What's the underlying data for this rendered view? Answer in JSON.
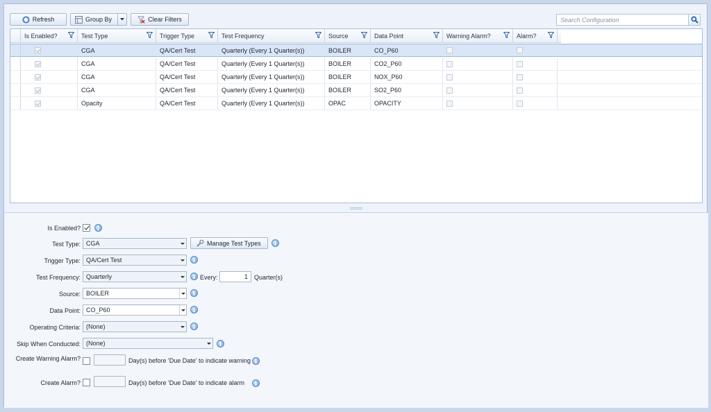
{
  "toolbar": {
    "refresh_label": "Refresh",
    "group_by_label": "Group By",
    "clear_filters_label": "Clear Filters",
    "search_placeholder": "Search Configuration"
  },
  "grid": {
    "columns": [
      "Is Enabled?",
      "Test Type",
      "Trigger Type",
      "Test Frequency",
      "Source",
      "Data Point",
      "Warning Alarm?",
      "Alarm?"
    ],
    "rows": [
      {
        "enabled": true,
        "test_type": "CGA",
        "trigger_type": "QA/Cert Test",
        "frequency": "Quarterly (Every 1 Quarter(s))",
        "source": "BOILER",
        "data_point": "CO_P60",
        "warning_alarm": false,
        "alarm": false,
        "selected": true
      },
      {
        "enabled": true,
        "test_type": "CGA",
        "trigger_type": "QA/Cert Test",
        "frequency": "Quarterly (Every 1 Quarter(s))",
        "source": "BOILER",
        "data_point": "CO2_P60",
        "warning_alarm": false,
        "alarm": false,
        "selected": false
      },
      {
        "enabled": true,
        "test_type": "CGA",
        "trigger_type": "QA/Cert Test",
        "frequency": "Quarterly (Every 1 Quarter(s))",
        "source": "BOILER",
        "data_point": "NOX_P60",
        "warning_alarm": false,
        "alarm": false,
        "selected": false
      },
      {
        "enabled": true,
        "test_type": "CGA",
        "trigger_type": "QA/Cert Test",
        "frequency": "Quarterly (Every 1 Quarter(s))",
        "source": "BOILER",
        "data_point": "SO2_P60",
        "warning_alarm": false,
        "alarm": false,
        "selected": false
      },
      {
        "enabled": true,
        "test_type": "Opacity",
        "trigger_type": "QA/Cert Test",
        "frequency": "Quarterly (Every 1 Quarter(s))",
        "source": "OPAC",
        "data_point": "OPACITY",
        "warning_alarm": false,
        "alarm": false,
        "selected": false
      }
    ]
  },
  "form": {
    "is_enabled_label": "Is Enabled?",
    "is_enabled": true,
    "test_type_label": "Test Type:",
    "test_type_value": "CGA",
    "manage_test_types_label": "Manage Test Types",
    "trigger_type_label": "Trigger Type:",
    "trigger_type_value": "QA/Cert Test",
    "test_frequency_label": "Test Frequency:",
    "test_frequency_value": "Quarterly",
    "every_label": "Every:",
    "every_value": "1",
    "every_unit": "Quarter(s)",
    "source_label": "Source:",
    "source_value": "BOILER",
    "data_point_label": "Data Point:",
    "data_point_value": "CO_P60",
    "operating_criteria_label": "Operating Criteria:",
    "operating_criteria_value": "(None)",
    "skip_when_label": "Skip When Conducted:",
    "skip_when_value": "(None)",
    "warning_alarm_label": "Create Warning Alarm?",
    "warning_alarm_text": "Day(s) before 'Due Date' to indicate warning",
    "alarm_label": "Create Alarm?",
    "alarm_text": "Day(s) before 'Due Date' to indicate alarm"
  },
  "colors": {
    "accent": "#6d9fd7",
    "selected_row": "#d9e6f7",
    "frame": "#a9bdd8"
  },
  "icons": [
    "refresh-icon",
    "group-by-icon",
    "clear-filters-icon",
    "search-icon",
    "filter-icon",
    "info-icon",
    "wrench-icon"
  ]
}
